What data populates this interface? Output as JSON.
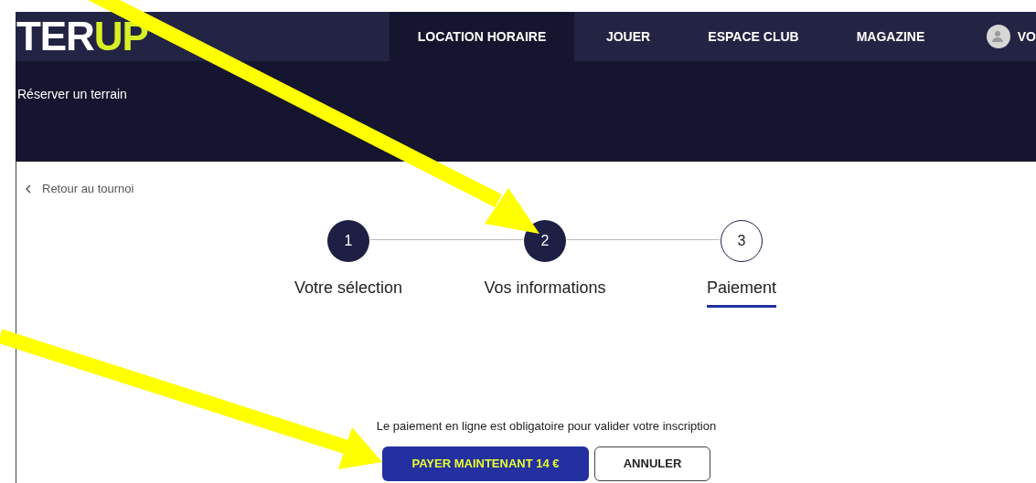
{
  "header": {
    "logo": {
      "part_1": "TER",
      "part_2": "UP"
    },
    "nav": [
      {
        "label": "LOCATION HORAIRE",
        "selected": true
      },
      {
        "label": "JOUER",
        "selected": false
      },
      {
        "label": "ESPACE CLUB",
        "selected": false
      },
      {
        "label": "MAGAZINE",
        "selected": false
      }
    ],
    "account": {
      "label": "VO"
    },
    "subtitle": "Réserver un terrain"
  },
  "back_link": "Retour au tournoi",
  "steps": [
    {
      "number": "1",
      "label": "Votre sélection",
      "done": true,
      "selected": false
    },
    {
      "number": "2",
      "label": "Vos informations",
      "done": true,
      "selected": false
    },
    {
      "number": "3",
      "label": "Paiement",
      "done": false,
      "selected": true
    }
  ],
  "payment": {
    "notice": "Le paiement en ligne est obligatoire pour valider votre inscription",
    "pay_button": "PAYER MAINTENANT 14 €",
    "cancel_button": "ANNULER"
  }
}
